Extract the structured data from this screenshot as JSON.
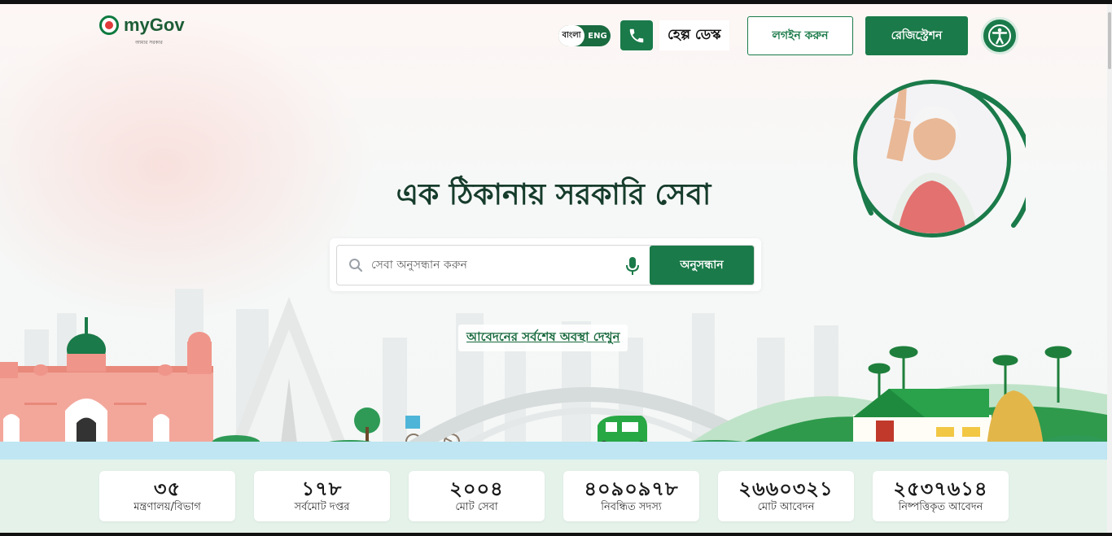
{
  "header": {
    "logo_text": "myGov",
    "logo_tagline": "আমার সরকার",
    "lang_bn": "বাংলা",
    "lang_en": "ENG",
    "help_label": "হেল্প ডেস্ক",
    "login_label": "লগইন করুন",
    "register_label": "রেজিস্ট্রেশন",
    "icons": {
      "help": "phone-icon",
      "accessibility": "accessibility-icon"
    }
  },
  "hero": {
    "headline": "এক ঠিকানায় সরকারি সেবা",
    "search": {
      "placeholder": "সেবা অনুসন্ধান করুন",
      "button_label": "অনুসন্ধান",
      "icons": [
        "search-icon",
        "mic-icon"
      ]
    },
    "status_link": "আবেদনের সর্বশেষ অবস্থা দেখুন"
  },
  "stats": [
    {
      "value": "৩৫",
      "label": "মন্ত্রণালয়/বিভাগ"
    },
    {
      "value": "১৭৮",
      "label": "সর্বমোট দপ্তর"
    },
    {
      "value": "২০০৪",
      "label": "মোট সেবা"
    },
    {
      "value": "৪০৯০৯৭৮",
      "label": "নিবন্ধিত সদস্য"
    },
    {
      "value": "২৬৬০৩২১",
      "label": "মোট আবেদন"
    },
    {
      "value": "২৫৩৭৬১৪",
      "label": "নিষ্পত্তিকৃত আবেদন"
    }
  ],
  "colors": {
    "brand_green": "#1a7a49",
    "headline": "#163c2c",
    "river": "#bfe6f2",
    "stats_band": "#e4f2ea"
  }
}
